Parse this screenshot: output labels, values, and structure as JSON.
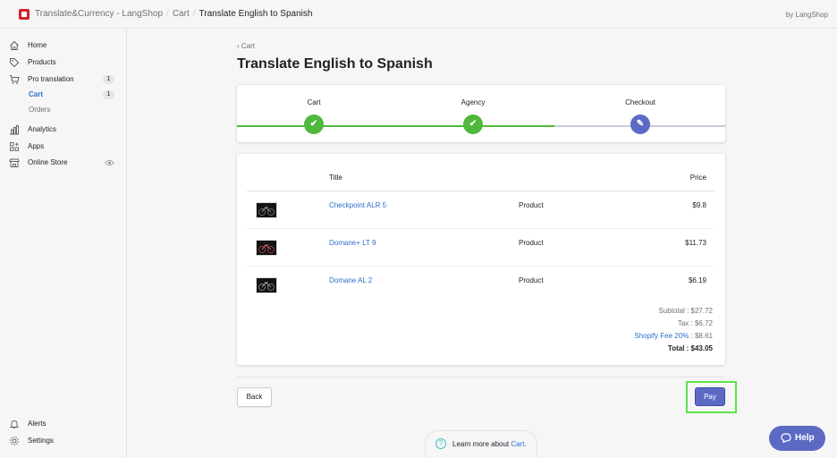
{
  "topbar": {
    "breadcrumb": [
      "Translate&Currency - LangShop",
      "Cart",
      "Translate English to Spanish"
    ],
    "byline": "by LangShop"
  },
  "sidebar": {
    "items": [
      {
        "label": "Home",
        "icon": "home-icon"
      },
      {
        "label": "Products",
        "icon": "tag-icon"
      },
      {
        "label": "Pro translation",
        "icon": "cart-icon",
        "badge": "1"
      },
      {
        "label": "Cart",
        "badge": "1"
      },
      {
        "label": "Orders"
      },
      {
        "label": "Analytics",
        "icon": "analytics-icon"
      },
      {
        "label": "Apps",
        "icon": "apps-icon"
      },
      {
        "label": "Online Store",
        "icon": "store-icon"
      }
    ],
    "bottom": [
      {
        "label": "Alerts",
        "icon": "bell-icon"
      },
      {
        "label": "Settings",
        "icon": "gear-icon"
      }
    ]
  },
  "page": {
    "back_label": "Cart",
    "title": "Translate English to Spanish"
  },
  "steps": [
    {
      "label": "Cart",
      "state": "complete"
    },
    {
      "label": "Agency",
      "state": "complete"
    },
    {
      "label": "Checkout",
      "state": "current"
    }
  ],
  "table": {
    "headers": {
      "title": "Title",
      "price": "Price"
    },
    "rows": [
      {
        "title": "Checkpoint ALR 5",
        "type": "Product",
        "price": "$9.8"
      },
      {
        "title": "Domane+ LT 9",
        "type": "Product",
        "price": "$11.73"
      },
      {
        "title": "Domane AL 2",
        "type": "Product",
        "price": "$6.19"
      }
    ],
    "summary": {
      "subtotal": "Subtotal : $27.72",
      "tax": "Tax : $6.72",
      "fee_label": "Shopify Fee 20%",
      "fee_value": " : $8.61",
      "total": "Total : $43.05"
    }
  },
  "actions": {
    "back_label": "Back",
    "pay_label": "Pay"
  },
  "footer": {
    "learn_text": "Learn more about ",
    "learn_link": "Cart."
  },
  "help": {
    "label": "Help"
  },
  "colors": {
    "accent": "#5c6ac4",
    "success": "#50b83c",
    "link": "#2c6ecb",
    "highlight": "#5de34a"
  }
}
